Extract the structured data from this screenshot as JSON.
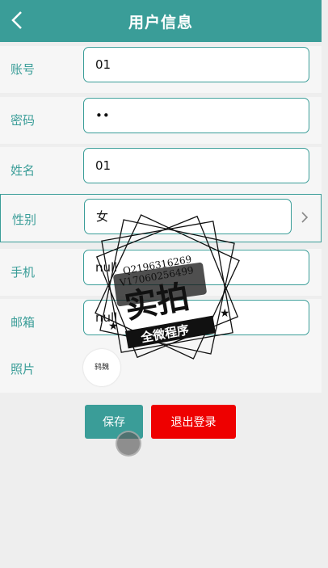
{
  "header": {
    "title": "用户信息",
    "back_icon": "chevron-left-icon"
  },
  "form": {
    "account": {
      "label": "账号",
      "value": "01"
    },
    "password": {
      "label": "密码",
      "value": "••"
    },
    "name": {
      "label": "姓名",
      "value": "01"
    },
    "gender": {
      "label": "性别",
      "value": "女"
    },
    "phone": {
      "label": "手机",
      "value": "null"
    },
    "email": {
      "label": "邮箱",
      "value": "null"
    },
    "photo": {
      "label": "照片",
      "thumb_text": "鸫魏"
    }
  },
  "buttons": {
    "save": "保存",
    "logout": "退出登录"
  },
  "watermark": {
    "line1": "Q2196316269",
    "line2": "V17060256499",
    "main": "实拍",
    "banner": "全微程序"
  },
  "colors": {
    "accent": "#3a9d98",
    "danger": "#ee0000"
  }
}
